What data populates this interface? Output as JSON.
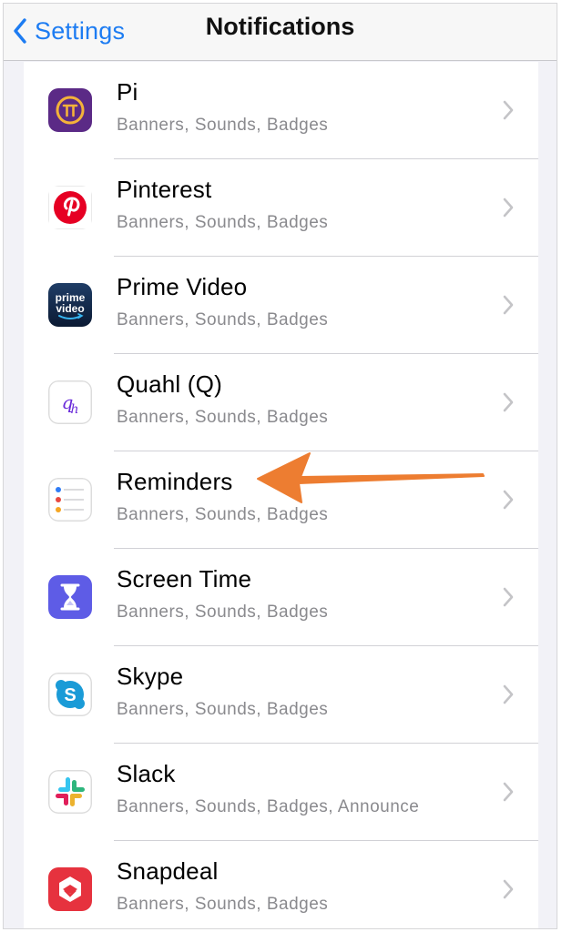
{
  "nav": {
    "back_label": "Settings",
    "title": "Notifications"
  },
  "apps": [
    {
      "name": "Pi",
      "subtitle": "Banners, Sounds, Badges",
      "icon": "pi-icon"
    },
    {
      "name": "Pinterest",
      "subtitle": "Banners, Sounds, Badges",
      "icon": "pinterest-icon"
    },
    {
      "name": "Prime Video",
      "subtitle": "Banners, Sounds, Badges",
      "icon": "prime-video-icon",
      "icon_text": [
        "prime",
        "video"
      ]
    },
    {
      "name": "Quahl (Q)",
      "subtitle": "Banners, Sounds, Badges",
      "icon": "quahl-icon",
      "icon_text": [
        "q",
        "h"
      ]
    },
    {
      "name": "Reminders",
      "subtitle": "Banners, Sounds, Badges",
      "icon": "reminders-icon"
    },
    {
      "name": "Screen Time",
      "subtitle": "Banners, Sounds, Badges",
      "icon": "hourglass-icon"
    },
    {
      "name": "Skype",
      "subtitle": "Banners, Sounds, Badges",
      "icon": "skype-icon",
      "icon_text": [
        "S"
      ]
    },
    {
      "name": "Slack",
      "subtitle": "Banners, Sounds, Badges, Announce",
      "icon": "slack-icon"
    },
    {
      "name": "Snapdeal",
      "subtitle": "Banners, Sounds, Badges",
      "icon": "snapdeal-icon"
    }
  ],
  "colors": {
    "ios_blue": "#1d7cf2",
    "annotation_arrow": "#ed7d31",
    "subtitle_gray": "#8a8a8e"
  }
}
